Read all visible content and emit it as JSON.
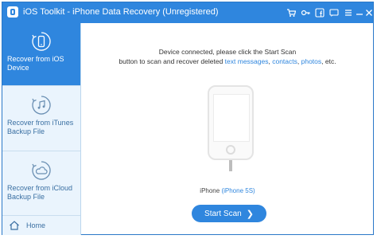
{
  "window": {
    "title": "iOS Toolkit - iPhone Data Recovery (Unregistered)",
    "icons": [
      "cart-icon",
      "key-icon",
      "facebook-icon",
      "feedback-icon",
      "menu-icon",
      "minimize-icon",
      "close-icon"
    ],
    "accent_color": "#2f86de"
  },
  "sidebar": {
    "items": [
      {
        "label": "Recover from iOS Device",
        "icon": "phone-refresh-icon",
        "active": true
      },
      {
        "label": "Recover from iTunes Backup File",
        "icon": "music-refresh-icon",
        "active": false
      },
      {
        "label": "Recover from iCloud Backup File",
        "icon": "cloud-refresh-icon",
        "active": false
      }
    ],
    "home": {
      "label": "Home",
      "icon": "home-icon"
    }
  },
  "main": {
    "message_line1": "Device connected, please click the Start Scan",
    "message_line2_prefix": "button to scan and recover deleted ",
    "link_text_messages": "text messages",
    "sep1": ", ",
    "link_contacts": "contacts",
    "sep2": ", ",
    "link_photos": "photos",
    "suffix": ", etc.",
    "device_name": "iPhone",
    "device_model": "(iPhone 5S)",
    "start_button": "Start Scan",
    "start_arrow": "❯"
  }
}
